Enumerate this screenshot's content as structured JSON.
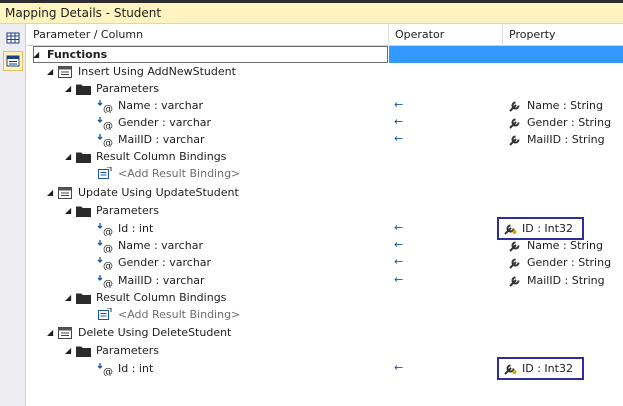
{
  "window": {
    "title": "Mapping Details - Student"
  },
  "columns": {
    "param": "Parameter / Column",
    "operator": "Operator",
    "property": "Property"
  },
  "functions_label": "Functions",
  "insert": {
    "label": "Insert Using AddNewStudent",
    "params_label": "Parameters",
    "params": [
      {
        "name": "Name : varchar",
        "op": "←",
        "prop": "Name : String"
      },
      {
        "name": "Gender : varchar",
        "op": "←",
        "prop": "Gender : String"
      },
      {
        "name": "MailID : varchar",
        "op": "←",
        "prop": "MailID : String"
      }
    ],
    "result_label": "Result Column Bindings",
    "add_binding": "<Add Result Binding>"
  },
  "update": {
    "label": "Update Using UpdateStudent",
    "params_label": "Parameters",
    "params": [
      {
        "name": "Id : int",
        "op": "←",
        "prop": "ID : Int32"
      },
      {
        "name": "Name : varchar",
        "op": "←",
        "prop": "Name : String"
      },
      {
        "name": "Gender : varchar",
        "op": "←",
        "prop": "Gender : String"
      },
      {
        "name": "MailID : varchar",
        "op": "←",
        "prop": "MailID : String"
      }
    ],
    "result_label": "Result Column Bindings",
    "add_binding": "<Add Result Binding>"
  },
  "delete": {
    "label": "Delete Using DeleteStudent",
    "params_label": "Parameters",
    "params": [
      {
        "name": "Id : int",
        "op": "←",
        "prop": "ID : Int32"
      }
    ]
  },
  "colors": {
    "selection": "#3399ff",
    "title_bg": "#fdf4bf",
    "highlight_box": "#2e2e9e",
    "operator_arrow": "#1a56a8"
  }
}
